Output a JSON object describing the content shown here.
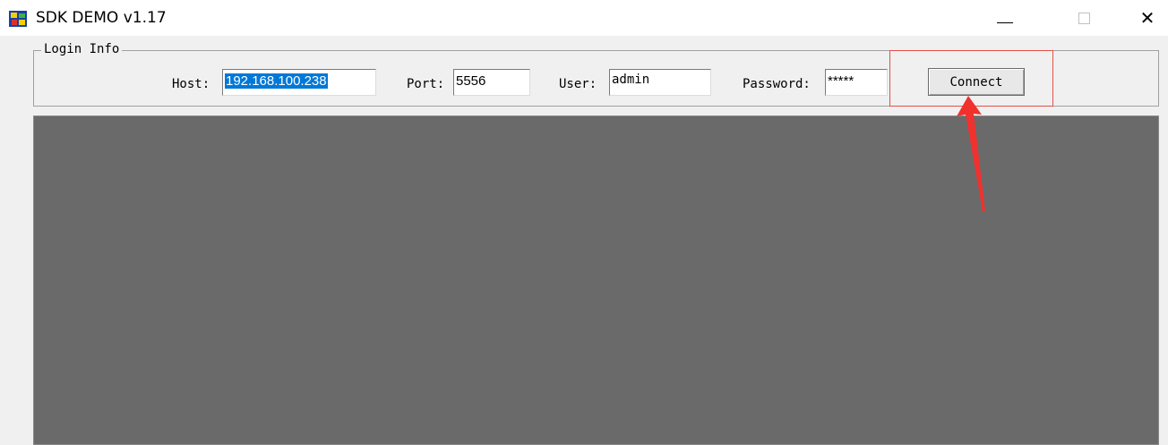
{
  "window": {
    "title": "SDK DEMO v1.17",
    "icon": "app-logo-icon",
    "controls": [
      "minimize-icon",
      "maximize-icon",
      "close-icon"
    ],
    "close_glyph": "✕"
  },
  "login_info": {
    "group_label": "Login Info",
    "host_label": "Host:",
    "host_value": "192.168.100.238",
    "port_label": "Port:",
    "port_value": "5556",
    "user_label": "User:",
    "user_value": "admin",
    "password_label": "Password:",
    "password_value": "*****",
    "connect_label": "Connect"
  },
  "annotation": {
    "highlight_color": "#e3504a"
  },
  "colors": {
    "selection": "#0078d7",
    "video_background": "#6a6a6a"
  }
}
